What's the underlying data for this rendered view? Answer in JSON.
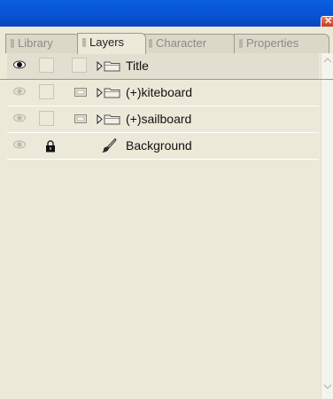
{
  "titlebar": {
    "close_icon": "close-icon",
    "color": "#0853d4"
  },
  "tabs": [
    {
      "label": "Library",
      "active": false
    },
    {
      "label": "Layers",
      "active": true
    },
    {
      "label": "Character",
      "active": false
    },
    {
      "label": "Properties",
      "active": false
    }
  ],
  "layers": [
    {
      "name": "Title",
      "visible": true,
      "locked": false,
      "type": "folder",
      "selected": true
    },
    {
      "name": "(+)kiteboard",
      "visible": false,
      "locked": false,
      "type": "folder",
      "selected": false
    },
    {
      "name": "(+)sailboard",
      "visible": false,
      "locked": false,
      "type": "folder",
      "selected": false
    },
    {
      "name": "Background",
      "visible": false,
      "locked": true,
      "type": "paint",
      "selected": false
    }
  ],
  "icons": {
    "eye": "eye-icon",
    "lock": "lock-icon",
    "mask": "mask-icon",
    "expand": "expand-arrow-icon",
    "folder": "folder-icon",
    "brush": "brush-icon"
  },
  "colors": {
    "panel": "#ece9d8",
    "titlebar": "#0853d4",
    "close": "#d6492a"
  }
}
